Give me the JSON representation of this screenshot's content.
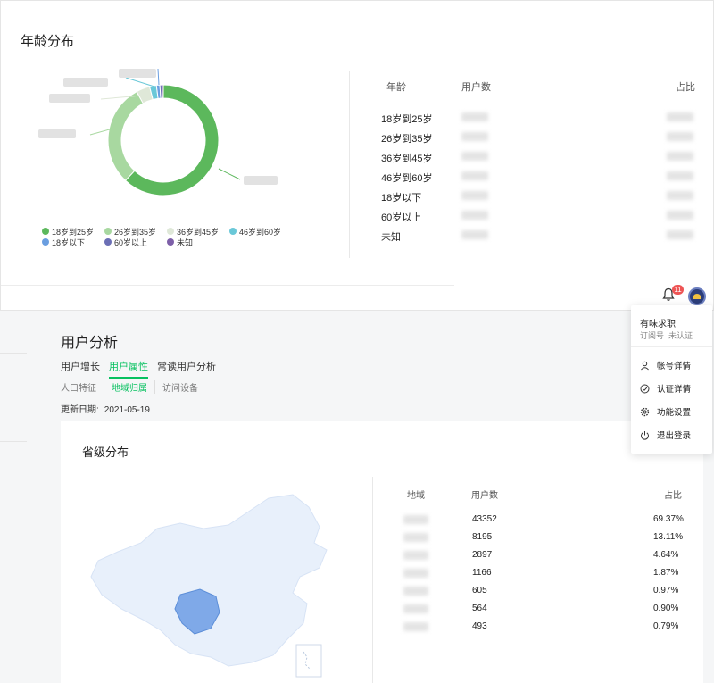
{
  "age_section": {
    "title": "年龄分布",
    "table_headers": {
      "age": "年龄",
      "users": "用户数",
      "ratio": "占比"
    },
    "rows": [
      "18岁到25岁",
      "26岁到35岁",
      "36岁到45岁",
      "46岁到60岁",
      "18岁以下",
      "60岁以上",
      "未知"
    ]
  },
  "chart_data": {
    "type": "pie",
    "style": "donut",
    "categories": [
      "18岁到25岁",
      "26岁到35岁",
      "36岁到45岁",
      "46岁到60岁",
      "18岁以下",
      "60岁以上",
      "未知"
    ],
    "values": [
      62,
      30,
      4,
      2,
      1,
      0.6,
      0.4
    ],
    "colors": [
      "#5cb85c",
      "#a8d8a0",
      "#dfe8d8",
      "#6ac8d8",
      "#6a9ee0",
      "#6b6fb5",
      "#7d5fa8"
    ],
    "legend_position": "bottom",
    "note": "segment values estimated from visual proportions"
  },
  "notifications": {
    "count": "11"
  },
  "user_analysis": {
    "title": "用户分析",
    "tabs": [
      "用户增长",
      "用户属性",
      "常读用户分析"
    ],
    "active_tab": 1,
    "subtabs": [
      "人口特征",
      "地域归属",
      "访问设备"
    ],
    "active_subtab": 1,
    "update_label": "更新日期:",
    "update_date": "2021-05-19"
  },
  "province_section": {
    "title": "省级分布",
    "headers": {
      "region": "地域",
      "users": "用户数",
      "ratio": "占比"
    },
    "users": [
      "43352",
      "8195",
      "2897",
      "1166",
      "605",
      "564",
      "493"
    ],
    "ratios": [
      "69.37%",
      "13.11%",
      "4.64%",
      "1.87%",
      "0.97%",
      "0.90%",
      "0.79%"
    ]
  },
  "account_menu": {
    "name": "有味求职",
    "type": "订阅号",
    "status": "未认证",
    "items": [
      "帐号详情",
      "认证详情",
      "功能设置",
      "退出登录"
    ]
  }
}
